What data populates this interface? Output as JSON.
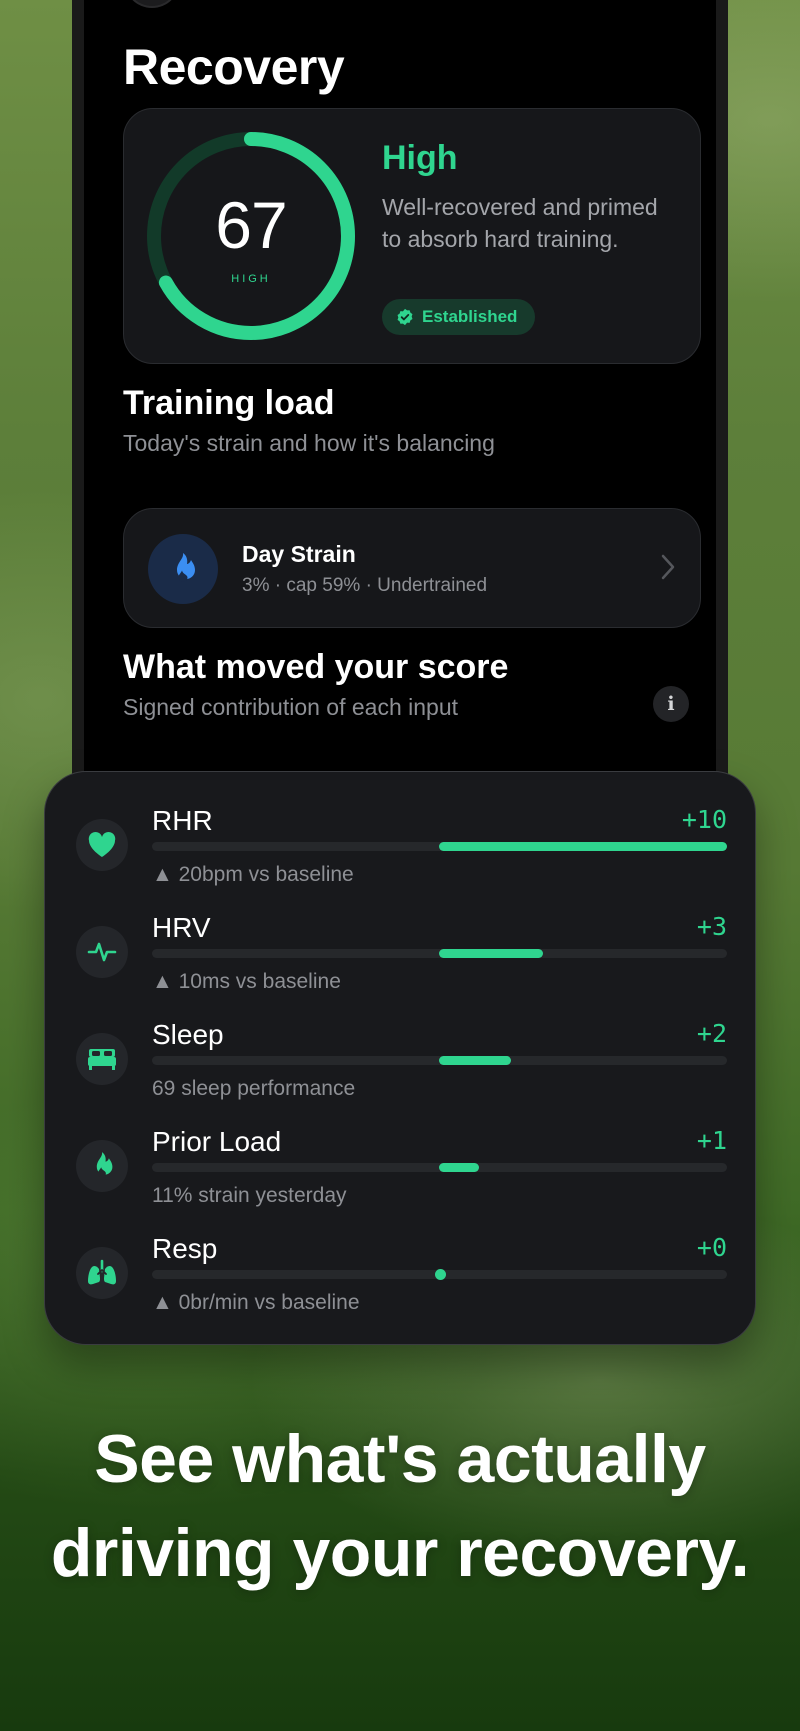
{
  "recovery": {
    "title": "Recovery",
    "score": "67",
    "score_fraction": 0.67,
    "score_label": "HIGH",
    "level": "High",
    "description": "Well-recovered and primed to absorb hard training.",
    "badge": "Established",
    "accent_color": "#2fd58f"
  },
  "training_load": {
    "title": "Training load",
    "subtitle": "Today's strain and how it's balancing",
    "card_title": "Day Strain",
    "card_subtitle": "3% · cap 59% · Undertrained",
    "icon": "flame-icon",
    "icon_color": "#3b8ef2"
  },
  "score_factors": {
    "title": "What moved your score",
    "subtitle": "Signed contribution of each input",
    "info_label": "i",
    "rows": [
      {
        "name": "RHR",
        "value": "+10",
        "fraction": 1.0,
        "note": "▲ 20bpm vs baseline",
        "icon": "heart-icon"
      },
      {
        "name": "HRV",
        "value": "+3",
        "fraction": 0.36,
        "note": "▲ 10ms vs baseline",
        "icon": "pulse-icon"
      },
      {
        "name": "Sleep",
        "value": "+2",
        "fraction": 0.25,
        "note": "69 sleep performance",
        "icon": "bed-icon"
      },
      {
        "name": "Prior Load",
        "value": "+1",
        "fraction": 0.14,
        "note": "11% strain yesterday",
        "icon": "flame-icon"
      },
      {
        "name": "Resp",
        "value": "+0",
        "fraction": 0.0,
        "note": "▲ 0br/min vs baseline",
        "icon": "lungs-icon"
      }
    ]
  },
  "headline": {
    "line1": "See what's actually",
    "line2": "driving your recovery."
  }
}
